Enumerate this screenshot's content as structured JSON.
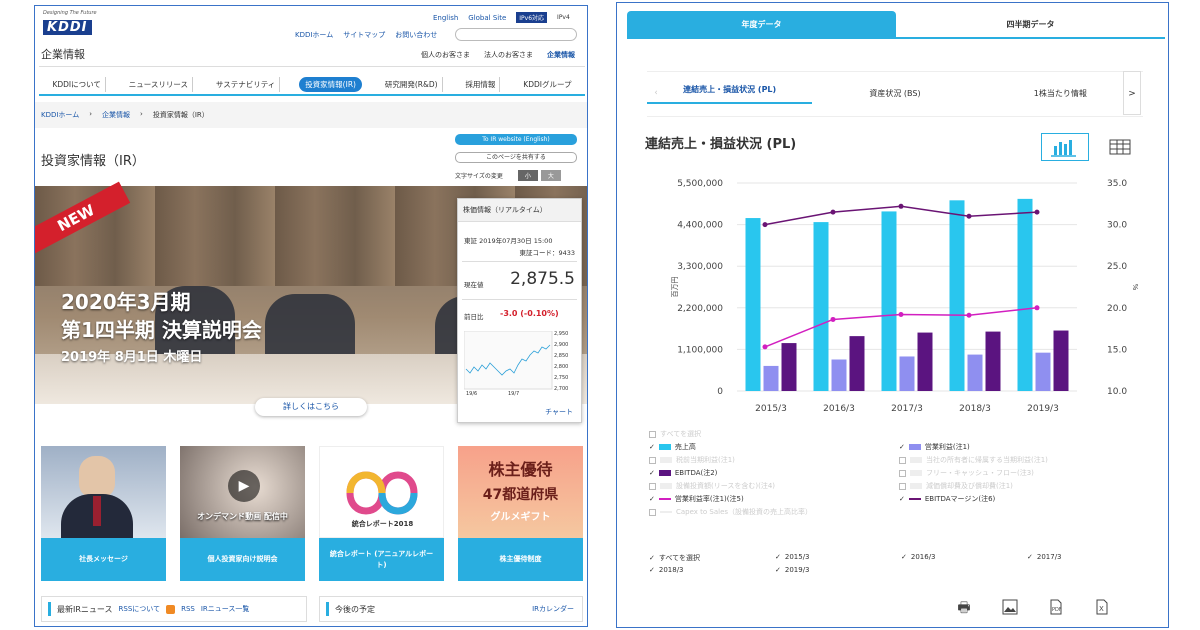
{
  "left": {
    "logo": {
      "caption": "Designing The Future",
      "mark": "KDDI"
    },
    "topnav": {
      "english": "English",
      "global": "Global Site",
      "ipv": "IPv6対応",
      "ipv4": "IPv4"
    },
    "utility": [
      "KDDIホーム",
      "サイトマップ",
      "お問い合わせ"
    ],
    "corp_title": "企業情報",
    "person_links": [
      "個人のお客さま",
      "法人のお客さま",
      "企業情報"
    ],
    "mainnav": [
      "KDDIについて",
      "ニュースリリース",
      "サステナビリティ",
      "投資家情報(IR)",
      "研究開発(R&D)",
      "採用情報",
      "KDDIグループ"
    ],
    "breadcrumb": [
      "KDDIホーム",
      "企業情報",
      "投資家情報（IR）"
    ],
    "page_title": "投資家情報（IR）",
    "ir_english": "To IR website (English)",
    "share": "このページを共有する",
    "font_size_label": "文字サイズの変更",
    "font_size": [
      "小",
      "大"
    ],
    "hero": {
      "badge": "NEW",
      "line1": "2020年3月期",
      "line2": "第1四半期 決算説明会",
      "date": "2019年 8月1日 木曜日",
      "detail": "詳しくはこちら"
    },
    "stock": {
      "title": "株価情報（リアルタイム）",
      "market": "東証 2019年07月30日 15:00",
      "code": "東証コード：9433",
      "price_label": "現在値",
      "price": "2,875.5",
      "change_label": "前日比",
      "change": "-3.0 (-0.10%)",
      "yticks": [
        "2,950",
        "2,900",
        "2,850",
        "2,800",
        "2,750",
        "2,700"
      ],
      "xticks": [
        "19/6",
        "19/7"
      ],
      "chart_link": "チャート"
    },
    "tiles": [
      {
        "label": "社長メッセージ"
      },
      {
        "label": "個人投資家向け説明会",
        "caption": "オンデマンド動画 配信中"
      },
      {
        "label": "統合レポート (アニュアルレポート)",
        "caption": "統合レポート2018"
      },
      {
        "label": "株主優待制度",
        "caption1": "株主優待",
        "caption2": "47都道府県",
        "caption3": "グルメギフト"
      }
    ],
    "news": {
      "title": "最新IRニュース",
      "rss_about": "RSSについて",
      "rss": "RSS",
      "list": "IRニュース一覧"
    },
    "schedule": {
      "title": "今後の予定",
      "link": "IRカレンダー"
    }
  },
  "right": {
    "tabs": [
      "年度データ",
      "四半期データ"
    ],
    "subtabs": [
      "連結売上・損益状況 (PL)",
      "資産状況 (BS)",
      "1株当たり情報"
    ],
    "chart_title": "連結売上・損益状況 (PL)",
    "legend": {
      "select_all": "すべてを選択",
      "items": [
        {
          "label": "売上高",
          "checked": true,
          "color": "#29c6ee"
        },
        {
          "label": "営業利益(注1)",
          "checked": true,
          "color": "#8f8ff0"
        },
        {
          "label": "税前当期利益(注1)",
          "checked": false
        },
        {
          "label": "当社の所有者に帰属する当期利益(注1)",
          "checked": false
        },
        {
          "label": "EBITDA(注2)",
          "checked": true,
          "color": "#5b1480"
        },
        {
          "label": "フリー・キャッシュ・フロー(注3)",
          "checked": false
        },
        {
          "label": "設備投資額(リースを含む)(注4)",
          "checked": false
        },
        {
          "label": "減価償却費及び償却費(注1)",
          "checked": false
        },
        {
          "label": "営業利益率(注1)(注5)",
          "checked": true,
          "color": "#d21fc0"
        },
        {
          "label": "EBITDAマージン(注6)",
          "checked": true,
          "color": "#6a1474"
        },
        {
          "label": "Capex to Sales（設備投資の売上高比率）",
          "checked": false
        }
      ]
    },
    "year_select": [
      "すべてを選択",
      "2015/3",
      "2016/3",
      "2017/3",
      "2018/3",
      "2019/3"
    ],
    "icons": [
      "printer-icon",
      "image-icon",
      "pdf-icon",
      "excel-icon"
    ]
  },
  "chart_data": {
    "type": "bar",
    "title": "連結売上・損益状況 (PL)",
    "categories": [
      "2015/3",
      "2016/3",
      "2017/3",
      "2018/3",
      "2019/3"
    ],
    "ylabel": "百万円",
    "y2label": "%",
    "ylim": [
      0,
      5500000
    ],
    "y2lim": [
      10.0,
      35.0
    ],
    "yticks": [
      "5,500,000",
      "4,400,000",
      "3,300,000",
      "2,200,000",
      "1,100,000",
      "0"
    ],
    "y2ticks": [
      "35.0",
      "30.0",
      "25.0",
      "20.0",
      "15.0",
      "10.0"
    ],
    "series": [
      {
        "name": "売上高",
        "kind": "bar",
        "axis": "left",
        "color": "#29c6ee",
        "values": [
          4573142,
          4466135,
          4748259,
          5041978,
          5080353
        ]
      },
      {
        "name": "営業利益(注1)",
        "kind": "bar",
        "axis": "left",
        "color": "#8f8ff0",
        "values": [
          663240,
          832930,
          912976,
          962799,
          1013729
        ]
      },
      {
        "name": "EBITDA(注2)",
        "kind": "bar",
        "axis": "left",
        "color": "#5b1480",
        "values": [
          1267000,
          1451000,
          1545000,
          1571000,
          1599000
        ]
      },
      {
        "name": "営業利益率(注1)(注5)",
        "kind": "line",
        "axis": "right",
        "color": "#d21fc0",
        "values": [
          15.3,
          18.6,
          19.2,
          19.1,
          20.0
        ]
      },
      {
        "name": "EBITDAマージン(注6)",
        "kind": "line",
        "axis": "right",
        "color": "#6a1474",
        "values": [
          30.0,
          31.5,
          32.2,
          31.0,
          31.5
        ]
      }
    ]
  }
}
